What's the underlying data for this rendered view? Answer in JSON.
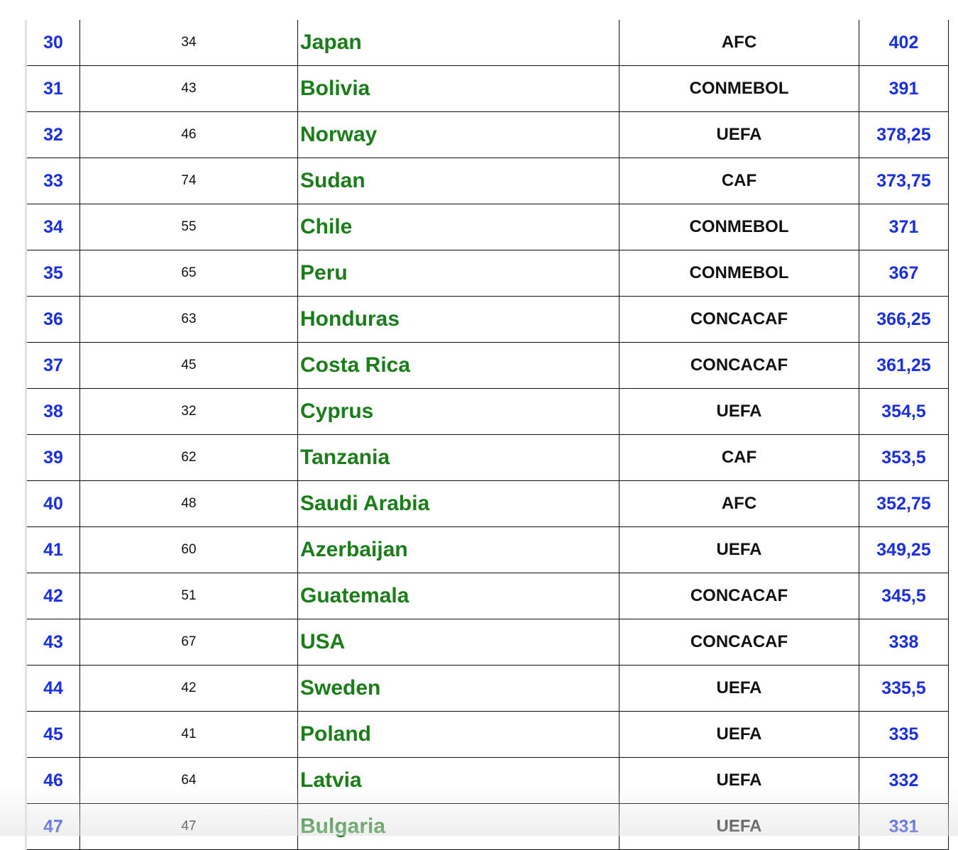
{
  "table": {
    "colors": {
      "rank": "#1a2fe0",
      "team": "#1a7d1a",
      "points": "#1a2fe0",
      "text": "#111111"
    },
    "rows": [
      {
        "rank": "30",
        "prev": "34",
        "team": "Japan",
        "confederation": "AFC",
        "points": "402"
      },
      {
        "rank": "31",
        "prev": "43",
        "team": "Bolivia",
        "confederation": "CONMEBOL",
        "points": "391"
      },
      {
        "rank": "32",
        "prev": "46",
        "team": "Norway",
        "confederation": "UEFA",
        "points": "378,25"
      },
      {
        "rank": "33",
        "prev": "74",
        "team": "Sudan",
        "confederation": "CAF",
        "points": "373,75"
      },
      {
        "rank": "34",
        "prev": "55",
        "team": "Chile",
        "confederation": "CONMEBOL",
        "points": "371"
      },
      {
        "rank": "35",
        "prev": "65",
        "team": "Peru",
        "confederation": "CONMEBOL",
        "points": "367"
      },
      {
        "rank": "36",
        "prev": "63",
        "team": "Honduras",
        "confederation": "CONCACAF",
        "points": "366,25"
      },
      {
        "rank": "37",
        "prev": "45",
        "team": "Costa Rica",
        "confederation": "CONCACAF",
        "points": "361,25"
      },
      {
        "rank": "38",
        "prev": "32",
        "team": "Cyprus",
        "confederation": "UEFA",
        "points": "354,5"
      },
      {
        "rank": "39",
        "prev": "62",
        "team": "Tanzania",
        "confederation": "CAF",
        "points": "353,5"
      },
      {
        "rank": "40",
        "prev": "48",
        "team": "Saudi Arabia",
        "confederation": "AFC",
        "points": "352,75"
      },
      {
        "rank": "41",
        "prev": "60",
        "team": "Azerbaijan",
        "confederation": "UEFA",
        "points": "349,25"
      },
      {
        "rank": "42",
        "prev": "51",
        "team": "Guatemala",
        "confederation": "CONCACAF",
        "points": "345,5"
      },
      {
        "rank": "43",
        "prev": "67",
        "team": "USA",
        "confederation": "CONCACAF",
        "points": "338"
      },
      {
        "rank": "44",
        "prev": "42",
        "team": "Sweden",
        "confederation": "UEFA",
        "points": "335,5"
      },
      {
        "rank": "45",
        "prev": "41",
        "team": "Poland",
        "confederation": "UEFA",
        "points": "335"
      },
      {
        "rank": "46",
        "prev": "64",
        "team": "Latvia",
        "confederation": "UEFA",
        "points": "332"
      },
      {
        "rank": "47",
        "prev": "47",
        "team": "Bulgaria",
        "confederation": "UEFA",
        "points": "331"
      }
    ]
  }
}
